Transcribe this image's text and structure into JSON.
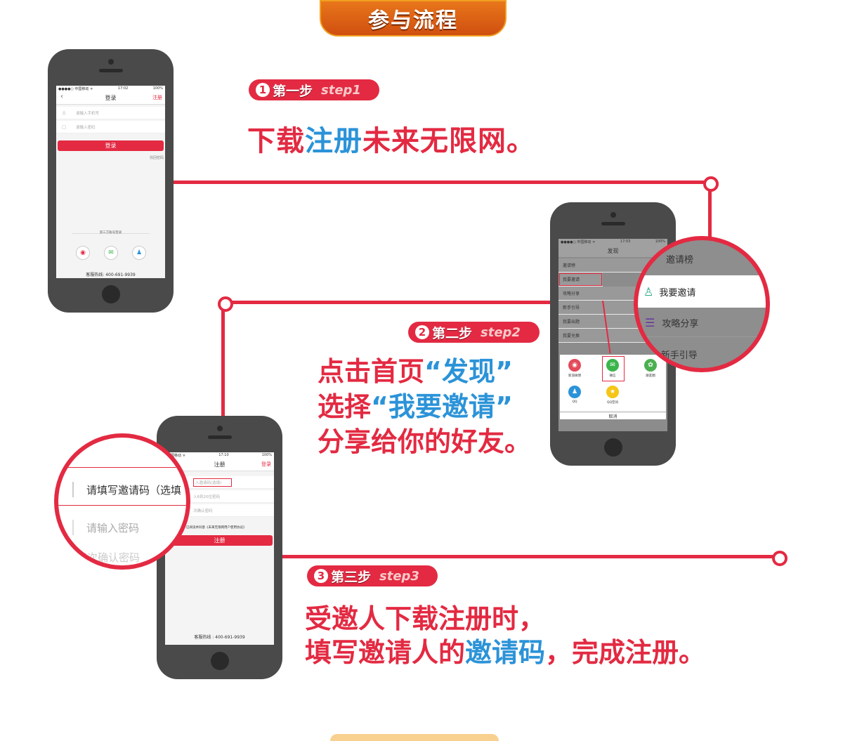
{
  "banner": {
    "title": "参与流程"
  },
  "colors": {
    "accent": "#e32a42",
    "highlight": "#2b93d8",
    "banner": "#e8761a"
  },
  "step1": {
    "num": "1",
    "label_cn": "第一步",
    "label_en": "step1",
    "text_a": "下载",
    "text_b": "注册",
    "text_c": "未来无限网。",
    "phone": {
      "status_left": "●●●●○ 中国移动 ᯤ",
      "status_time": "17:02",
      "status_right": "100%",
      "nav_title": "登录",
      "nav_right": "注册",
      "back_icon": "chevron-left-icon",
      "phone_placeholder": "请输入手机号",
      "password_placeholder": "请输入密码",
      "login_button": "登录",
      "forgot_link": "找回密码",
      "third_party_label": "第三方账号登录",
      "social_icons": [
        "weibo-icon",
        "wechat-icon",
        "qq-icon"
      ],
      "hotline": "客服热线: 400-691-9939"
    }
  },
  "step2": {
    "num": "2",
    "label_cn": "第二步",
    "label_en": "step2",
    "line1_a": "点击首页",
    "line1_b": "“发现”",
    "line2_a": "选择",
    "line2_b": "“我要邀请”",
    "line3": "分享给你的好友。",
    "phone": {
      "status_left": "●●●●○ 中国移动 ᯤ",
      "status_time": "17:03",
      "status_right": "100%",
      "nav_title": "发现",
      "menu": [
        "邀请榜",
        "我要邀请",
        "攻略分享",
        "新手引导",
        "我要出题",
        "我要兑换"
      ],
      "share_options": [
        "新浪微博",
        "微信",
        "朋友圈",
        "QQ",
        "QQ空间"
      ],
      "cancel": "取消"
    },
    "zoom": [
      "邀请榜",
      "我要邀请",
      "攻略分享",
      "新手引导"
    ]
  },
  "step3": {
    "num": "3",
    "label_cn": "第三步",
    "label_en": "step3",
    "line1": "受邀人下载注册时，",
    "line2_a": "填写邀请人的",
    "line2_b": "邀请码",
    "line2_c": "，完成注册。",
    "phone": {
      "status_left": "中国移动 ᯤ",
      "status_time": "17:10",
      "status_right": "100%",
      "nav_title": "注册",
      "nav_right": "登录",
      "invite_placeholder": "入邀请码(选填)",
      "password_placeholder": "入6到20位密码",
      "confirm_placeholder": "次确认密码",
      "agreement": "已阅读并同意《未来无限网用户使用协议》",
      "register_button": "注册",
      "hotline": "客服热线 : 400-691-9939"
    },
    "zoom": {
      "invite": "请填写邀请码（选填",
      "password": "请输入密码",
      "confirm": "再次确认密码"
    }
  }
}
